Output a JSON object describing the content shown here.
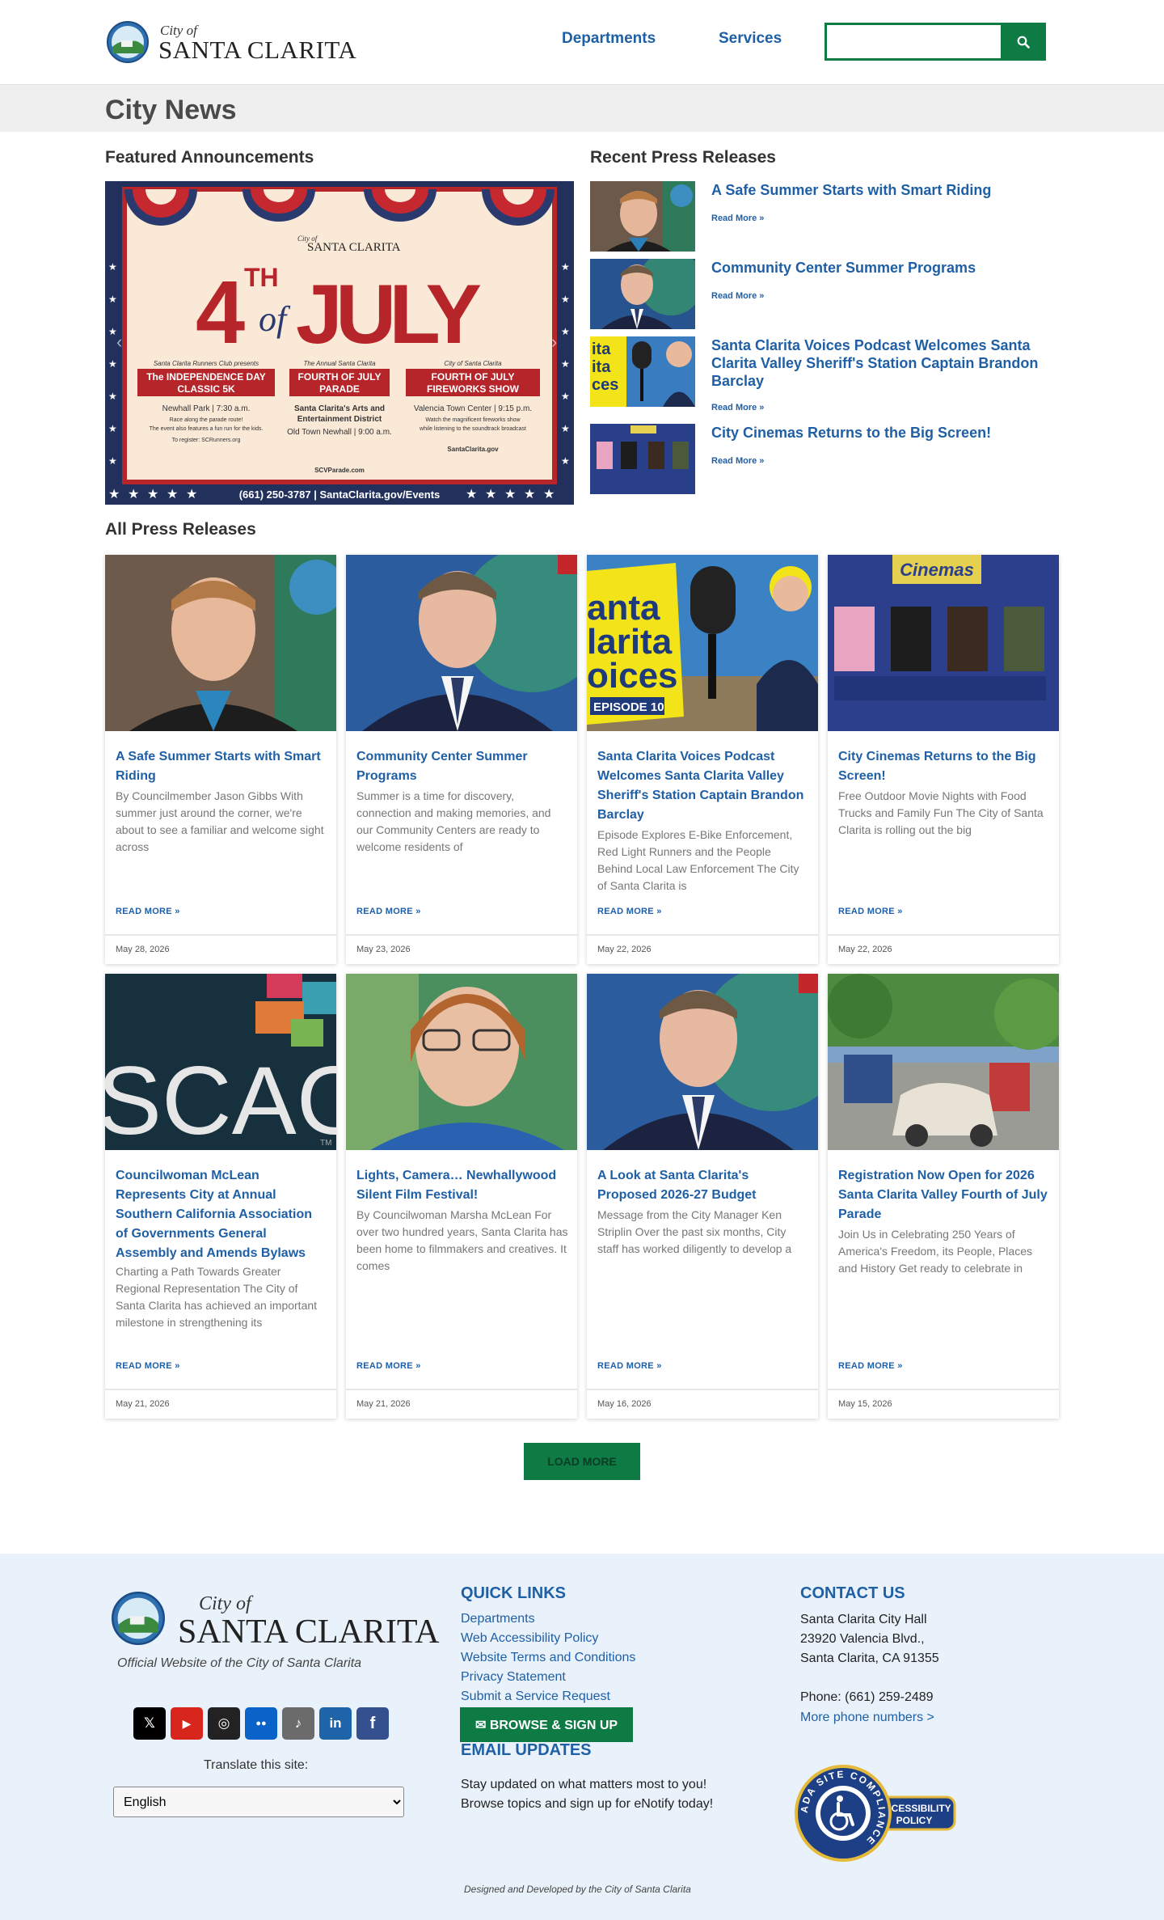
{
  "header": {
    "logo_cityof": "City of",
    "logo_name": "SANTA CLARITA",
    "nav": [
      "Departments",
      "Services"
    ],
    "search_placeholder": ""
  },
  "page_title": "City News",
  "featured": {
    "heading": "Featured Announcements",
    "poster": {
      "brand_cityof": "City of",
      "brand_name": "SANTA CLARITA",
      "headline_num": "4",
      "headline_sup": "TH",
      "headline_of": "of",
      "headline_word": "JULY",
      "events": [
        {
          "presenter": "Santa Clarita Runners Club presents",
          "name_line1": "The INDEPENDENCE DAY",
          "name_line2": "CLASSIC 5K",
          "loc": "Newhall Park | 7:30 a.m.",
          "d1": "Race along the parade route!",
          "d2": "The event also features a fun run for the kids.",
          "d3": "To register: SCRunners.org"
        },
        {
          "presenter": "The Annual Santa Clarita",
          "name_line1": "FOURTH OF JULY",
          "name_line2": "PARADE",
          "loc": "Santa Clarita's Arts and",
          "d1": "Entertainment District",
          "d2": "Old Town Newhall | 9:00 a.m.",
          "d3": "SCVParade.com"
        },
        {
          "presenter": "City of Santa Clarita",
          "name_line1": "FOURTH OF JULY",
          "name_line2": "FIREWORKS SHOW",
          "loc": "Valencia Town Center | 9:15 p.m.",
          "d1": "Watch the magnificent fireworks show",
          "d2": "while listening to the soundtrack broadcast",
          "d3": "SantaClarita.gov"
        }
      ],
      "footer": "(661) 250-3787 | SantaClarita.gov/Events"
    }
  },
  "recent": {
    "heading": "Recent Press Releases",
    "items": [
      {
        "title": "A Safe Summer Starts with Smart Riding",
        "more": "Read More »"
      },
      {
        "title": "Community Center Summer Programs",
        "more": "Read More »"
      },
      {
        "title": "Santa Clarita Voices Podcast Welcomes Santa Clarita Valley Sheriff's Station Captain Brandon Barclay",
        "more": "Read More »"
      },
      {
        "title": "City Cinemas Returns to the Big Screen!",
        "more": "Read More »"
      }
    ]
  },
  "all": {
    "heading": "All Press Releases",
    "cards": [
      {
        "title": "A Safe Summer Starts with Smart Riding",
        "excerpt": "By Councilmember Jason Gibbs With summer just around the corner, we're about to see a familiar and welcome sight across",
        "more": "READ MORE »",
        "date": "May 28, 2026"
      },
      {
        "title": "Community Center Summer Programs",
        "excerpt": "Summer is a time for discovery, connection and making memories, and our Community Centers are ready to welcome residents of",
        "more": "READ MORE »",
        "date": "May 23, 2026"
      },
      {
        "title": "Santa Clarita Voices Podcast Welcomes Santa Clarita Valley Sheriff's Station Captain Brandon Barclay",
        "excerpt": "Episode Explores E-Bike Enforcement, Red Light Runners and the People Behind Local Law Enforcement The City of Santa Clarita is",
        "more": "READ MORE »",
        "date": "May 22, 2026"
      },
      {
        "title": "City Cinemas Returns to the Big Screen!",
        "excerpt": "Free Outdoor Movie Nights with Food Trucks and Family Fun The City of Santa Clarita is rolling out the big",
        "more": "READ MORE »",
        "date": "May 22, 2026"
      },
      {
        "title": "Councilwoman McLean Represents City at Annual Southern California Association of Governments General Assembly and Amends Bylaws",
        "excerpt": "Charting a Path Towards Greater Regional Representation The City of Santa Clarita has achieved an important milestone in strengthening its",
        "more": "READ MORE »",
        "date": "May 21, 2026"
      },
      {
        "title": "Lights, Camera… Newhallywood Silent Film Festival!",
        "excerpt": "By Councilwoman Marsha McLean For over two hundred years, Santa Clarita has been home to filmmakers and creatives. It comes",
        "more": "READ MORE »",
        "date": "May 21, 2026"
      },
      {
        "title": "A Look at Santa Clarita's Proposed 2026-27 Budget",
        "excerpt": "Message from the City Manager Ken Striplin Over the past six months, City staff has worked diligently to develop a",
        "more": "READ MORE »",
        "date": "May 16, 2026"
      },
      {
        "title": "Registration Now Open for 2026 Santa Clarita Valley Fourth of July Parade",
        "excerpt": "Join Us in Celebrating 250 Years of America's Freedom, its People, Places and History        Get ready to celebrate in",
        "more": "READ MORE »",
        "date": "May 15, 2026"
      }
    ],
    "images": {
      "scag_text": "SCAG",
      "scag_tm": "TM",
      "cinema_title": "Cinemas",
      "podcast_lines": [
        "anta",
        "larita",
        "oices"
      ],
      "podcast_episode": "EPISODE 10",
      "recent_podcast_lines": [
        "ita",
        "ita",
        "ces"
      ]
    }
  },
  "load_more": "LOAD MORE",
  "footer": {
    "cityof": "City of",
    "name": "SANTA CLARITA",
    "tagline": "Official Website of the City of Santa Clarita",
    "socials": [
      {
        "icon": "x-icon",
        "glyph": "𝕏",
        "color": "#000000"
      },
      {
        "icon": "youtube-icon",
        "glyph": "▶",
        "color": "#d9261c"
      },
      {
        "icon": "instagram-icon",
        "glyph": "◎",
        "color": "#222222"
      },
      {
        "icon": "flickr-icon",
        "glyph": "●●",
        "color": "#0a63c9"
      },
      {
        "icon": "tiktok-icon",
        "glyph": "♪",
        "color": "#6b6b6b"
      },
      {
        "icon": "linkedin-icon",
        "glyph": "in",
        "color": "#1f63a8"
      },
      {
        "icon": "facebook-icon",
        "glyph": "f",
        "color": "#35508f"
      }
    ],
    "translate_label": "Translate this site:",
    "language": "English",
    "quick_links_heading": "QUICK LINKS",
    "quick_links": [
      "Departments",
      "Web Accessibility Policy",
      "Website Terms and Conditions",
      "Privacy Statement",
      "Submit a Service Request"
    ],
    "email_heading": "EMAIL UPDATES",
    "email_text_1": "Stay updated on what matters most to you!",
    "email_text_2": "Browse topics and sign up for eNotify today!",
    "signup": "BROWSE & SIGN UP",
    "contact_heading": "CONTACT US",
    "address": [
      "Santa Clarita City Hall",
      "23920 Valencia Blvd.,",
      "Santa Clarita, CA 91355"
    ],
    "phone": "Phone: (661) 259-2489",
    "more_phone": "More phone numbers >",
    "ada_ring": "ADA SITE COMPLIANCE",
    "ada_badge_1": "ACCESSIBILITY",
    "ada_badge_2": "POLICY",
    "credit": "Designed and Developed by the City of Santa Clarita"
  }
}
